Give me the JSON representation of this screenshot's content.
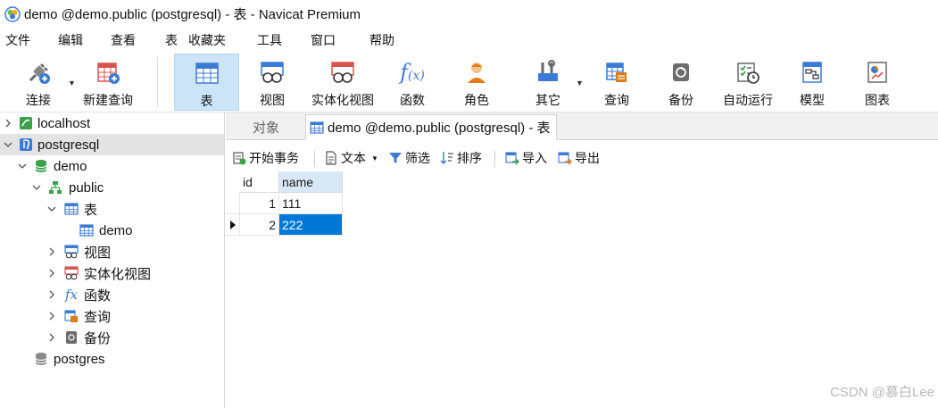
{
  "window": {
    "title": "demo @demo.public (postgresql) - 表 - Navicat Premium"
  },
  "menu": [
    "文件",
    "编辑",
    "查看",
    "表",
    "收藏夹",
    "工具",
    "窗口",
    "帮助"
  ],
  "toolbar": {
    "connect": "连接",
    "new_query": "新建查询",
    "table": "表",
    "view": "视图",
    "materialized_view": "实体化视图",
    "function": "函数",
    "role": "角色",
    "other": "其它",
    "query": "查询",
    "backup": "备份",
    "automation": "自动运行",
    "model": "模型",
    "chart": "图表"
  },
  "sidebar": {
    "localhost": "localhost",
    "postgresql": "postgresql",
    "demo_db": "demo",
    "public": "public",
    "tables": "表",
    "demo_table": "demo",
    "views": "视图",
    "mat_views": "实体化视图",
    "functions": "函数",
    "queries": "查询",
    "backups": "备份",
    "postgres": "postgres"
  },
  "tabs": {
    "objects": "对象",
    "active": "demo @demo.public (postgresql) - 表"
  },
  "subtoolbar": {
    "begin_transaction": "开始事务",
    "text": "文本",
    "filter": "筛选",
    "sort": "排序",
    "import": "导入",
    "export": "导出"
  },
  "grid": {
    "columns": [
      "id",
      "name"
    ],
    "rows": [
      {
        "id": "1",
        "name": "111"
      },
      {
        "id": "2",
        "name": "222"
      }
    ]
  },
  "watermark": "CSDN @慕白Lee",
  "colors": {
    "accent": "#0078d7",
    "active_tool": "#cce4f7",
    "selected_tree": "#e3e3e3"
  }
}
